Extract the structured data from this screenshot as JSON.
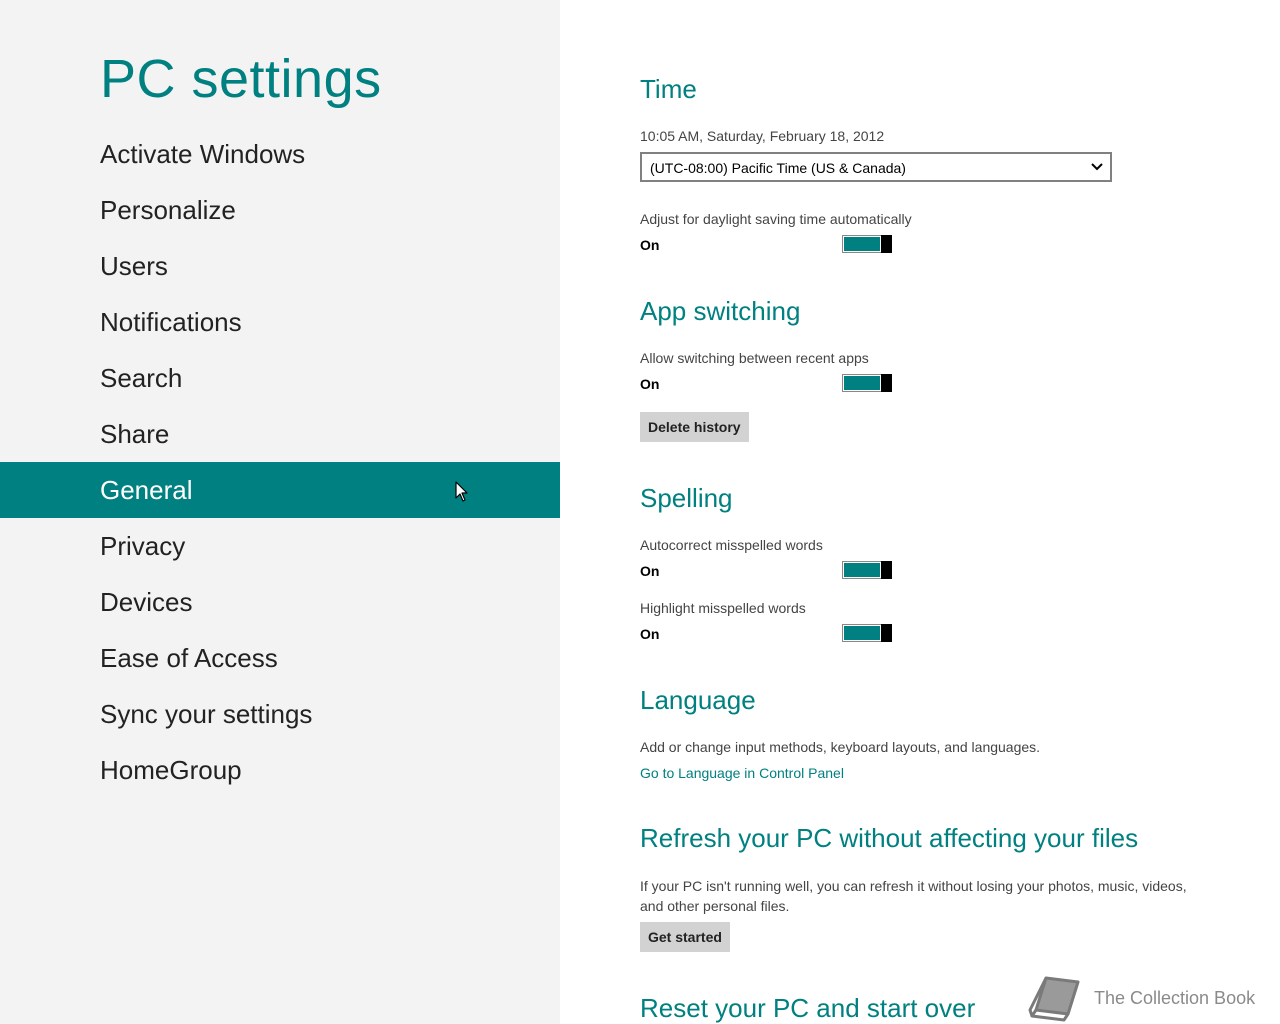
{
  "sidebar": {
    "title": "PC settings",
    "items": [
      {
        "label": "Activate Windows",
        "selected": false
      },
      {
        "label": "Personalize",
        "selected": false
      },
      {
        "label": "Users",
        "selected": false
      },
      {
        "label": "Notifications",
        "selected": false
      },
      {
        "label": "Search",
        "selected": false
      },
      {
        "label": "Share",
        "selected": false
      },
      {
        "label": "General",
        "selected": true
      },
      {
        "label": "Privacy",
        "selected": false
      },
      {
        "label": "Devices",
        "selected": false
      },
      {
        "label": "Ease of Access",
        "selected": false
      },
      {
        "label": "Sync your settings",
        "selected": false
      },
      {
        "label": "HomeGroup",
        "selected": false
      }
    ]
  },
  "time": {
    "title": "Time",
    "current": "10:05 AM, Saturday, February 18, 2012",
    "timezone": "(UTC-08:00) Pacific Time (US & Canada)",
    "dst_label": "Adjust for daylight saving time automatically",
    "dst_state": "On"
  },
  "app_switching": {
    "title": "App switching",
    "allow_label": "Allow switching between recent apps",
    "allow_state": "On",
    "delete_button": "Delete history"
  },
  "spelling": {
    "title": "Spelling",
    "autocorrect_label": "Autocorrect misspelled words",
    "autocorrect_state": "On",
    "highlight_label": "Highlight misspelled words",
    "highlight_state": "On"
  },
  "language": {
    "title": "Language",
    "description": "Add or change input methods, keyboard layouts, and languages.",
    "link": "Go to Language in Control Panel"
  },
  "refresh": {
    "title": "Refresh your PC without affecting your files",
    "description": "If your PC isn't running well, you can refresh it without losing your photos, music, videos, and other personal files.",
    "button": "Get started"
  },
  "reset": {
    "title": "Reset your PC and start over"
  },
  "watermark": {
    "text": "The Collection Book",
    "icon": "book-icon"
  },
  "colors": {
    "accent": "#008080",
    "sidebar_bg": "#f3f3f3"
  }
}
